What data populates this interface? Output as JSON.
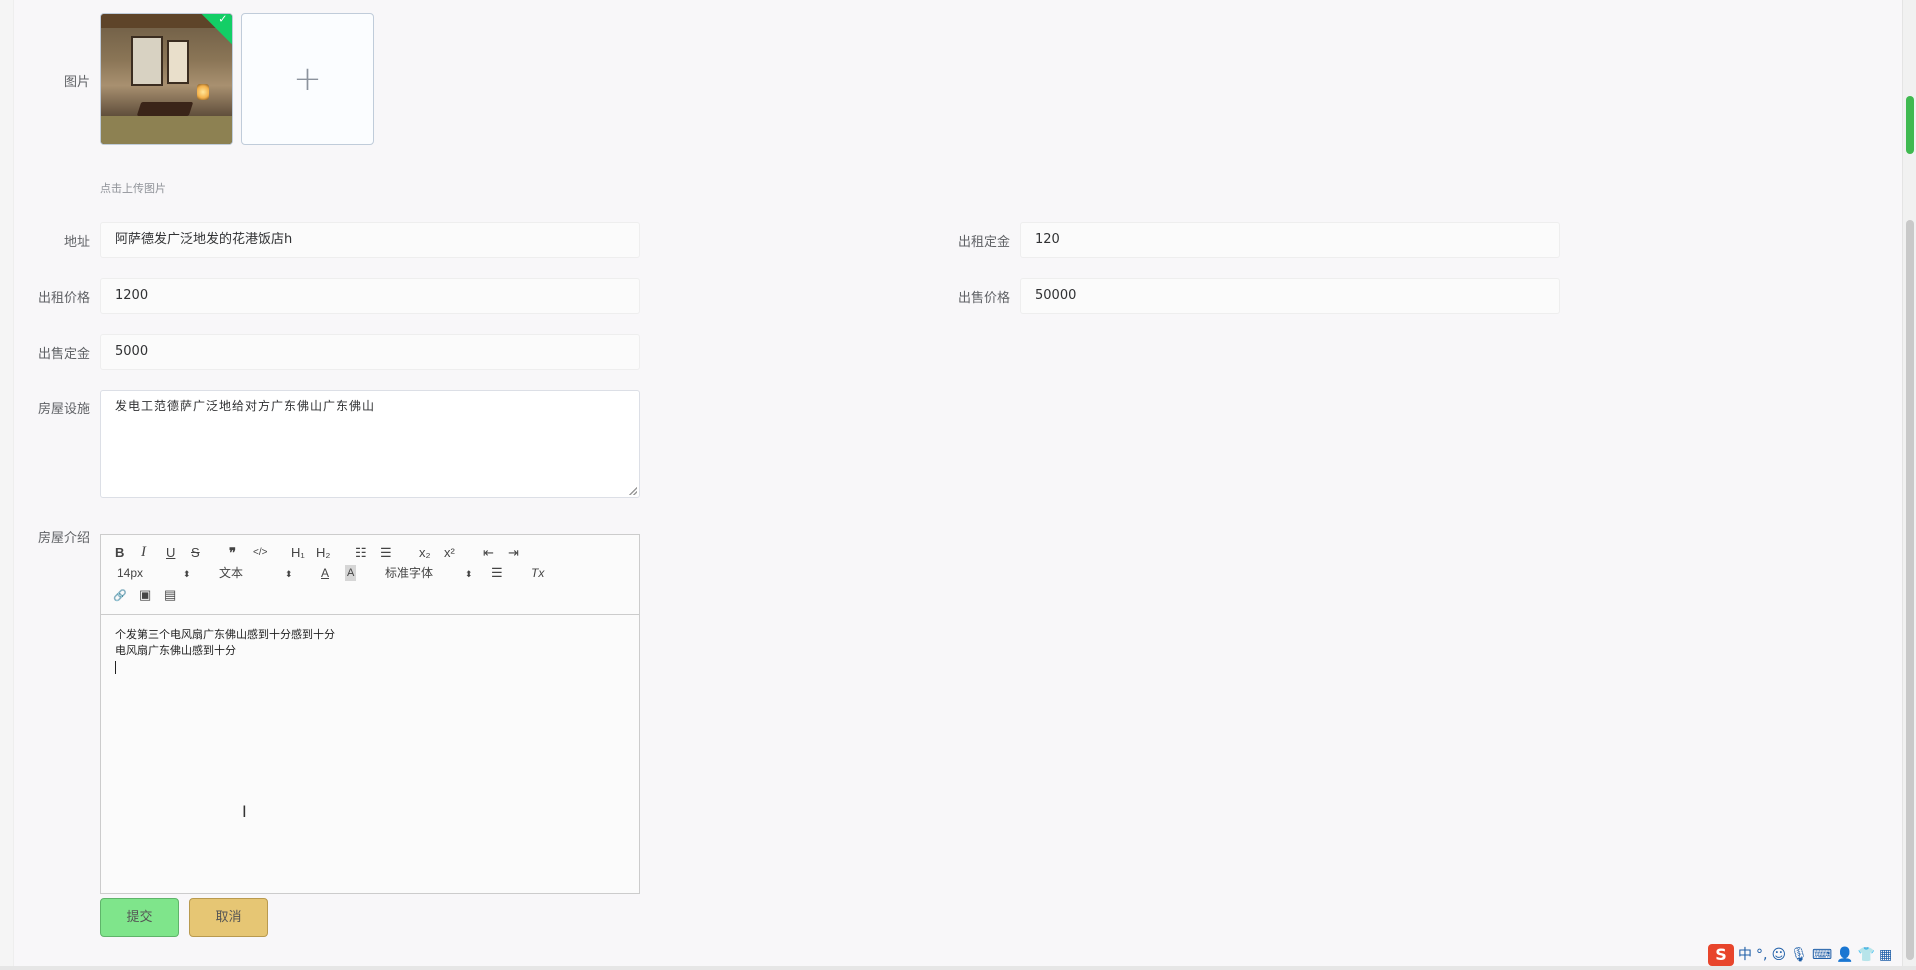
{
  "form": {
    "image_label": "图片",
    "upload_hint": "点击上传图片",
    "upload_plus": "+",
    "uploaded_check": "✓",
    "address_label": "地址",
    "address_value": "阿萨德发广泛地发的花港饭店h",
    "rent_deposit_label": "出租定金",
    "rent_deposit_value": "120",
    "rent_price_label": "出租价格",
    "rent_price_value": "1200",
    "sale_price_label": "出售价格",
    "sale_price_value": "50000",
    "sale_deposit_label": "出售定金",
    "sale_deposit_value": "5000",
    "facilities_label": "房屋设施",
    "facilities_value": "发电工范德萨广泛地给对方广东佛山广东佛山",
    "intro_label": "房屋介绍",
    "intro_lines": [
      "个发第三个电风扇广东佛山感到十分感到十分",
      "电风扇广东佛山感到十分"
    ]
  },
  "editor": {
    "toolbar": {
      "bold": "B",
      "italic": "I",
      "underline": "U",
      "strike": "S",
      "blockquote": "❞",
      "code": "</>",
      "h1": "H₁",
      "h2": "H₂",
      "ordered_list": "☷",
      "bullet_list": "☰",
      "subscript": "x₂",
      "superscript": "x²",
      "outdent": "⇤",
      "indent": "⇥",
      "size_value": "14px",
      "header_value": "文本",
      "font_value": "标准字体",
      "select_arrow": "⬍",
      "color": "A",
      "background": "A",
      "align": "☰",
      "clean": "Tx",
      "link": "🔗",
      "image": "▣",
      "video": "▤"
    }
  },
  "buttons": {
    "submit_label": "提交",
    "cancel_label": "取消"
  },
  "tray": {
    "ime_logo": "S",
    "ime_lang": "中",
    "punct": "°,",
    "emoji": "☺",
    "mic": "🎙",
    "keyboard": "⌨",
    "user": "👤",
    "shirt": "👕",
    "grid": "▦"
  },
  "colors": {
    "submit_bg": "#7fe58b",
    "cancel_bg": "#e6c674",
    "check_badge": "#13ce66",
    "scroll_indicator": "#3fb950"
  }
}
